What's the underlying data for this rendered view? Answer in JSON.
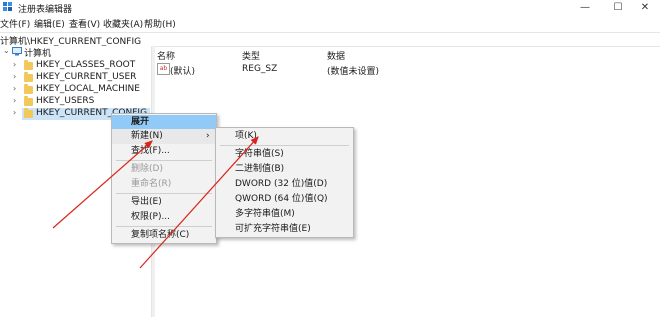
{
  "window": {
    "title": "注册表编辑器",
    "icons": {
      "app": "regedit-icon",
      "minimize": "minimize-icon",
      "maximize": "maximize-icon",
      "close": "close-icon"
    },
    "minimize_glyph": "—",
    "maximize_glyph": "☐",
    "close_glyph": "✕"
  },
  "menubar": {
    "file": "文件(F)",
    "edit": "编辑(E)",
    "view": "查看(V)",
    "favorites": "收藏夹(A)",
    "help": "帮助(H)"
  },
  "address": "计算机\\HKEY_CURRENT_CONFIG",
  "tree": {
    "root": "计算机",
    "items": [
      {
        "label": "HKEY_CLASSES_ROOT"
      },
      {
        "label": "HKEY_CURRENT_USER"
      },
      {
        "label": "HKEY_LOCAL_MACHINE"
      },
      {
        "label": "HKEY_USERS"
      },
      {
        "label": "HKEY_CURRENT_CONFIG"
      }
    ]
  },
  "list": {
    "headers": {
      "name": "名称",
      "type": "类型",
      "data": "数据"
    },
    "rows": [
      {
        "name": "(默认)",
        "type": "REG_SZ",
        "data": "(数值未设置)",
        "icon": "string-value-icon",
        "icon_text": "ab"
      }
    ]
  },
  "context_menu": {
    "expand": "展开",
    "new": "新建(N)",
    "find": "查找(F)...",
    "delete": "删除(D)",
    "rename": "重命名(R)",
    "export": "导出(E)",
    "permissions": "权限(P)...",
    "copy_key_name": "复制项名称(C)",
    "submenu_arrow": "›"
  },
  "submenu": {
    "key": "项(K)",
    "string": "字符串值(S)",
    "binary": "二进制值(B)",
    "dword": "DWORD (32 位)值(D)",
    "qword": "QWORD (64 位)值(Q)",
    "multi_string": "多字符串值(M)",
    "expandable_string": "可扩充字符串值(E)"
  },
  "colors": {
    "highlight": "#91c9f7",
    "tree_selection": "#cce4f7",
    "annotation_arrow": "#d9261c",
    "folder": "#f3c85a"
  }
}
